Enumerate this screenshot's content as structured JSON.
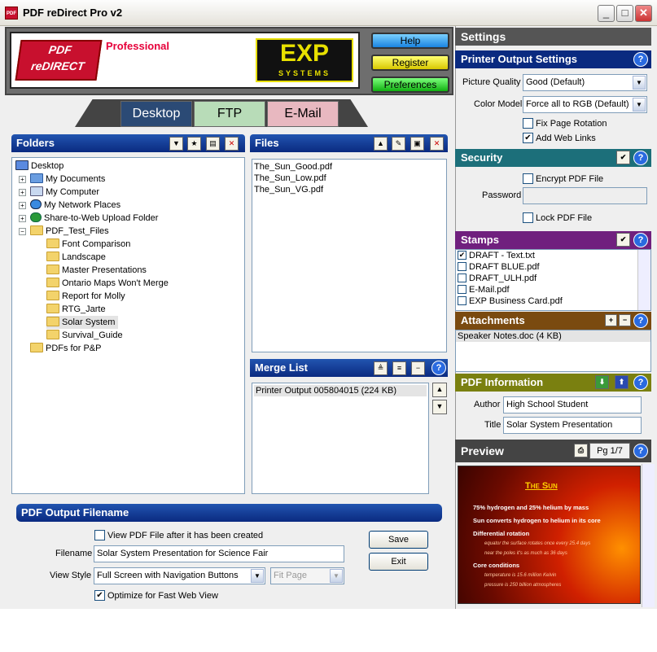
{
  "window": {
    "title": "PDF reDirect Pro v2",
    "icon": "pdf-app-icon"
  },
  "branding": {
    "logo_text": "PDF reDIRECT",
    "professional": "Professional",
    "exp_logo": "EXP",
    "exp_sub": "SYSTEMS"
  },
  "top_buttons": {
    "help": "Help",
    "register": "Register",
    "preferences": "Preferences"
  },
  "tabs": [
    {
      "label": "Desktop"
    },
    {
      "label": "FTP"
    },
    {
      "label": "E-Mail"
    }
  ],
  "folders": {
    "title": "Folders",
    "tree": [
      "Desktop",
      "My Documents",
      "My Computer",
      "My Network Places",
      "Share-to-Web Upload Folder",
      "PDF_Test_Files",
      "Font Comparison",
      "Landscape",
      "Master Presentations",
      "Ontario Maps Won't Merge",
      "Report for Molly",
      "RTG_Jarte",
      "Solar System",
      "Survival_Guide",
      "PDFs for P&P"
    ]
  },
  "files": {
    "title": "Files",
    "items": [
      "The_Sun_Good.pdf",
      "The_Sun_Low.pdf",
      "The_Sun_VG.pdf"
    ]
  },
  "merge": {
    "title": "Merge List",
    "items": [
      "Printer Output 005804015 (224 KB)"
    ]
  },
  "output": {
    "title": "PDF Output Filename",
    "view_after_label": "View PDF File after it has been created",
    "filename_label": "Filename",
    "filename_value": "Solar System Presentation for Science Fair",
    "view_style_label": "View Style",
    "view_style_value": "Full Screen with Navigation Buttons",
    "fit_page": "Fit Page",
    "optimize_label": "Optimize for Fast Web View",
    "save": "Save",
    "exit": "Exit"
  },
  "settings": {
    "title": "Settings",
    "printer": {
      "title": "Printer Output Settings",
      "quality_label": "Picture Quality",
      "quality_value": "Good (Default)",
      "color_label": "Color Model",
      "color_value": "Force all  to RGB (Default)",
      "fix_rotation": "Fix Page Rotation",
      "add_links": "Add Web Links"
    },
    "security": {
      "title": "Security",
      "encrypt": "Encrypt PDF File",
      "password_label": "Password",
      "lock": "Lock PDF File"
    },
    "stamps": {
      "title": "Stamps",
      "items": [
        "DRAFT - Text.txt",
        "DRAFT BLUE.pdf",
        "DRAFT_ULH.pdf",
        "E-Mail.pdf",
        "EXP Business Card.pdf"
      ]
    },
    "attachments": {
      "title": "Attachments",
      "items": [
        "Speaker Notes.doc (4 KB)"
      ]
    },
    "info": {
      "title": "PDF Information",
      "author_label": "Author",
      "author_value": "High School Student",
      "title_label": "Title",
      "title_value": "Solar System Presentation"
    }
  },
  "preview": {
    "title": "Preview",
    "page": "Pg 1/7",
    "slide": {
      "heading": "The Sun",
      "lines": [
        "75% hydrogen and 25% helium by mass",
        "Sun converts hydrogen to helium in its core",
        "Differential rotation",
        "equator the surface rotates once every 25.4 days",
        "near the poles it's as much as 36 days",
        "Core conditions",
        "temperature is 15.6 million Kelvin",
        "pressure is 250 billion atmospheres"
      ]
    }
  },
  "colors": {
    "folders_header": "#0a2a80",
    "printer_header": "#0a2a80",
    "security_header": "#1c6f7a",
    "stamps_header": "#70207e",
    "attachments_header": "#7a4a10",
    "info_header": "#7a8010",
    "preview_header": "#444444"
  }
}
